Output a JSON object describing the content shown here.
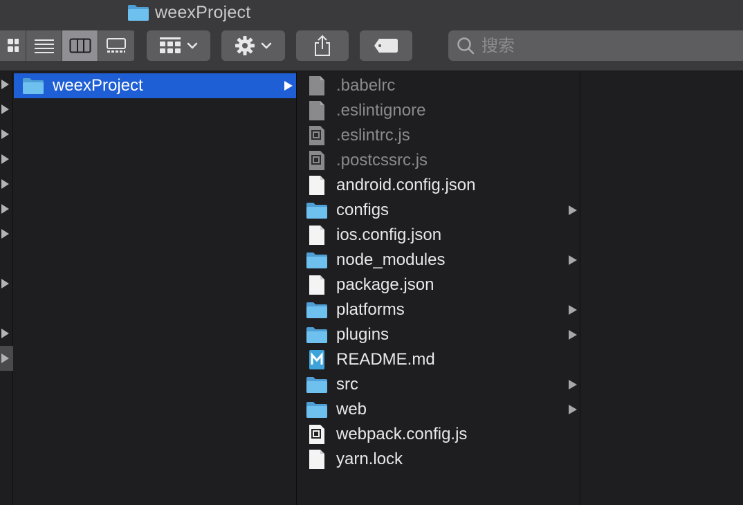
{
  "window": {
    "title": "weexProject"
  },
  "toolbar": {
    "view_modes": [
      "icon-view",
      "list-view",
      "column-view",
      "gallery-view"
    ],
    "active_view": "column-view",
    "group_button": "group-by-icon",
    "action_button": "gear-icon",
    "share_button": "share-icon",
    "tag_button": "tag-icon"
  },
  "search": {
    "placeholder": "搜索",
    "value": ""
  },
  "column1": {
    "items": [
      {
        "label": "weexProject",
        "type": "folder",
        "has_children": true,
        "selected": true
      }
    ]
  },
  "column2": {
    "items": [
      {
        "label": ".babelrc",
        "type": "file-generic",
        "hidden": true,
        "has_children": false
      },
      {
        "label": ".eslintignore",
        "type": "file-generic",
        "hidden": true,
        "has_children": false
      },
      {
        "label": ".eslintrc.js",
        "type": "file-js",
        "hidden": true,
        "has_children": false
      },
      {
        "label": ".postcssrc.js",
        "type": "file-js",
        "hidden": true,
        "has_children": false
      },
      {
        "label": "android.config.json",
        "type": "file-doc",
        "hidden": false,
        "has_children": false
      },
      {
        "label": "configs",
        "type": "folder",
        "hidden": false,
        "has_children": true
      },
      {
        "label": "ios.config.json",
        "type": "file-doc",
        "hidden": false,
        "has_children": false
      },
      {
        "label": "node_modules",
        "type": "folder",
        "hidden": false,
        "has_children": true
      },
      {
        "label": "package.json",
        "type": "file-doc",
        "hidden": false,
        "has_children": false
      },
      {
        "label": "platforms",
        "type": "folder",
        "hidden": false,
        "has_children": true
      },
      {
        "label": "plugins",
        "type": "folder",
        "hidden": false,
        "has_children": true
      },
      {
        "label": "README.md",
        "type": "file-md",
        "hidden": false,
        "has_children": false
      },
      {
        "label": "src",
        "type": "folder",
        "hidden": false,
        "has_children": true
      },
      {
        "label": "web",
        "type": "folder",
        "hidden": false,
        "has_children": true
      },
      {
        "label": "webpack.config.js",
        "type": "file-js-light",
        "hidden": false,
        "has_children": false
      },
      {
        "label": "yarn.lock",
        "type": "file-doc",
        "hidden": false,
        "has_children": false
      }
    ]
  },
  "colors": {
    "selection": "#1f5fd6",
    "folder": "#5fb3e6",
    "toolbar": "#3a3a3c",
    "background": "#1e1e20"
  }
}
